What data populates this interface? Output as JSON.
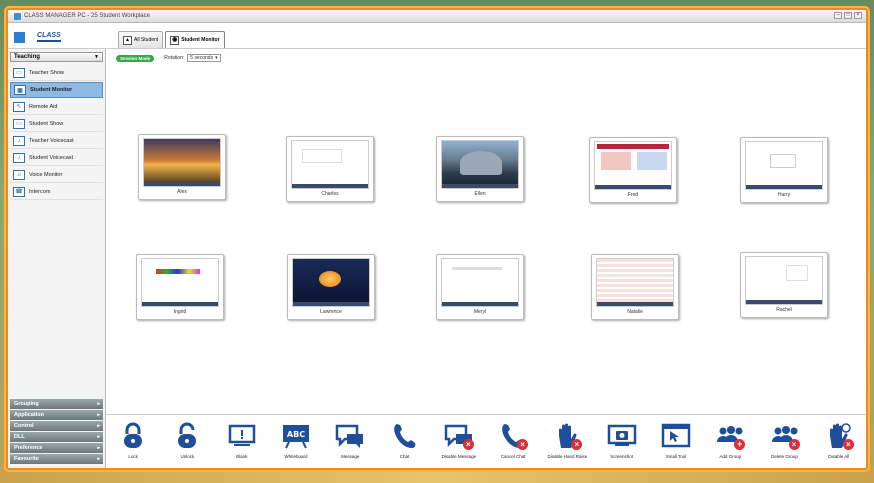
{
  "window": {
    "title": "CLASS MANAGER PC - 25 Student Workplace"
  },
  "header": {
    "logo_primary": "",
    "logo_secondary": "CLASS",
    "tabs": [
      {
        "label": "All Student",
        "icon": "students-icon",
        "active": false
      },
      {
        "label": "Student Monitor",
        "icon": "monitor-icon",
        "active": true
      }
    ]
  },
  "sidebar": {
    "section_title": "Teaching",
    "items": [
      {
        "label": "Teacher Show",
        "icon": "teacher-show-icon",
        "active": false
      },
      {
        "label": "Student Monitor",
        "icon": "monitor-icon",
        "active": true
      },
      {
        "label": "Remote Aid",
        "icon": "remote-aid-icon",
        "active": false
      },
      {
        "label": "Student Show",
        "icon": "student-show-icon",
        "active": false
      },
      {
        "label": "Teacher Voicecast",
        "icon": "voicecast-icon",
        "active": false
      },
      {
        "label": "Student Voicecast",
        "icon": "voicecast-icon",
        "active": false
      },
      {
        "label": "Voice Monitor",
        "icon": "voice-monitor-icon",
        "active": false
      },
      {
        "label": "Intercom",
        "icon": "intercom-icon",
        "active": false
      }
    ],
    "categories": [
      "Grouping",
      "Application",
      "Control",
      "DLL",
      "Preference",
      "Favourite"
    ]
  },
  "main": {
    "session_badge": "Session Mode",
    "rotation_label": "Rotation:",
    "rotation_value": "5 seconds",
    "students": [
      {
        "name": "Alex"
      },
      {
        "name": "Charles"
      },
      {
        "name": "Ellen"
      },
      {
        "name": "Fred"
      },
      {
        "name": "Harry"
      },
      {
        "name": "Ingrid"
      },
      {
        "name": "Lawrence"
      },
      {
        "name": "Meryl"
      },
      {
        "name": "Natalie"
      },
      {
        "name": "Rachel"
      }
    ]
  },
  "toolbar": {
    "buttons": [
      {
        "label": "Lock",
        "icon": "lock-icon"
      },
      {
        "label": "Unlock",
        "icon": "unlock-icon"
      },
      {
        "label": "Blank",
        "icon": "blank-screen-icon"
      },
      {
        "label": "Whiteboard",
        "icon": "whiteboard-icon"
      },
      {
        "label": "Message",
        "icon": "message-icon"
      },
      {
        "label": "Chat",
        "icon": "chat-icon"
      },
      {
        "label": "Disable Message",
        "icon": "disable-message-icon"
      },
      {
        "label": "Cancel Chat",
        "icon": "cancel-chat-icon"
      },
      {
        "label": "Disable Hand Raise",
        "icon": "disable-hand-raise-icon"
      },
      {
        "label": "Screenshot",
        "icon": "screenshot-icon"
      },
      {
        "label": "Small Tool",
        "icon": "small-tool-icon"
      },
      {
        "label": "Add Group",
        "icon": "add-group-icon"
      },
      {
        "label": "Delete Group",
        "icon": "delete-group-icon"
      },
      {
        "label": "Disable All",
        "icon": "disable-all-icon"
      }
    ]
  },
  "colors": {
    "accent": "#1f4f9a",
    "frame": "#f08a1c",
    "session": "#3aa84a",
    "active_item": "#8fb9e3",
    "badge": "#d9303a"
  }
}
